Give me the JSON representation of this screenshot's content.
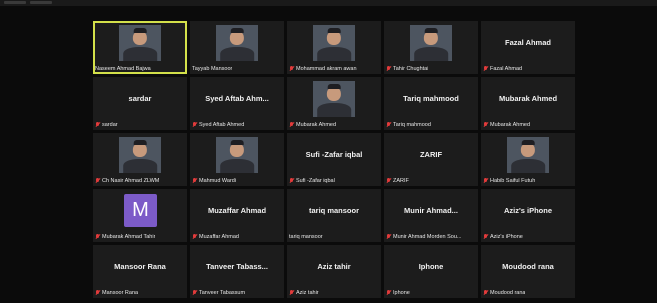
{
  "participants": [
    {
      "label": "Naseem Ahmad Bajwa",
      "display": "",
      "video": "photo",
      "muted": false,
      "active": true
    },
    {
      "label": "Tayyab Mansoor",
      "display": "",
      "video": "photo",
      "muted": false
    },
    {
      "label": "Mohammad akram awan",
      "display": "",
      "video": "photo",
      "muted": true
    },
    {
      "label": "Tahir Chughtai",
      "display": "",
      "video": "photo",
      "muted": true
    },
    {
      "label": "Fazal Ahmad",
      "display": "Fazal Ahmad",
      "video": "none",
      "muted": true
    },
    {
      "label": "sardar",
      "display": "sardar",
      "video": "none",
      "muted": true
    },
    {
      "label": "Syed Aftab Ahmed",
      "display": "Syed Aftab Ahm...",
      "video": "none",
      "muted": true
    },
    {
      "label": "Mubarak Ahmed",
      "display": "",
      "video": "photo",
      "muted": true
    },
    {
      "label": "Tariq mahmood",
      "display": "Tariq mahmood",
      "video": "none",
      "muted": true
    },
    {
      "label": "Mubarak Ahmed",
      "display": "Mubarak Ahmed",
      "video": "none",
      "muted": true
    },
    {
      "label": "Ch Nasir Ahmad ZLWM",
      "display": "",
      "video": "photo",
      "muted": true
    },
    {
      "label": "Mahmud Wardi",
      "display": "",
      "video": "photo",
      "muted": true
    },
    {
      "label": "Sufi -Zafar iqbal",
      "display": "Sufi -Zafar iqbal",
      "video": "none",
      "muted": true
    },
    {
      "label": "ZARIF",
      "display": "ZARIF",
      "video": "none",
      "muted": true
    },
    {
      "label": "Habib Saiful Futuh",
      "display": "",
      "video": "photo",
      "muted": true
    },
    {
      "label": "Mubarak Ahmad Tahir",
      "display": "",
      "video": "avatar",
      "avatar_letter": "M",
      "muted": true
    },
    {
      "label": "Muzaffar Ahmad",
      "display": "Muzaffar Ahmad",
      "video": "none",
      "muted": true
    },
    {
      "label": "tariq mansoor",
      "display": "tariq mansoor",
      "video": "none",
      "muted": false
    },
    {
      "label": "Munir Ahmad Morden Sou...",
      "display": "Munir Ahmad...",
      "video": "none",
      "muted": true
    },
    {
      "label": "Aziz's iPhone",
      "display": "Aziz's iPhone",
      "video": "none",
      "muted": true
    },
    {
      "label": "Mansoor Rana",
      "display": "Mansoor Rana",
      "video": "none",
      "muted": true
    },
    {
      "label": "Tanveer Tabassum",
      "display": "Tanveer Tabass...",
      "video": "none",
      "muted": true
    },
    {
      "label": "Aziz tahir",
      "display": "Aziz tahir",
      "video": "none",
      "muted": true
    },
    {
      "label": "Iphone",
      "display": "Iphone",
      "video": "none",
      "muted": true
    },
    {
      "label": "Moudood rana",
      "display": "Moudood rana",
      "video": "none",
      "muted": true
    }
  ],
  "colors": {
    "active_speaker_border": "#d3e04a",
    "muted_icon": "#e23b3b",
    "tile_bg": "#1c1c1c",
    "avatar_bg": "#7c5bc8"
  }
}
